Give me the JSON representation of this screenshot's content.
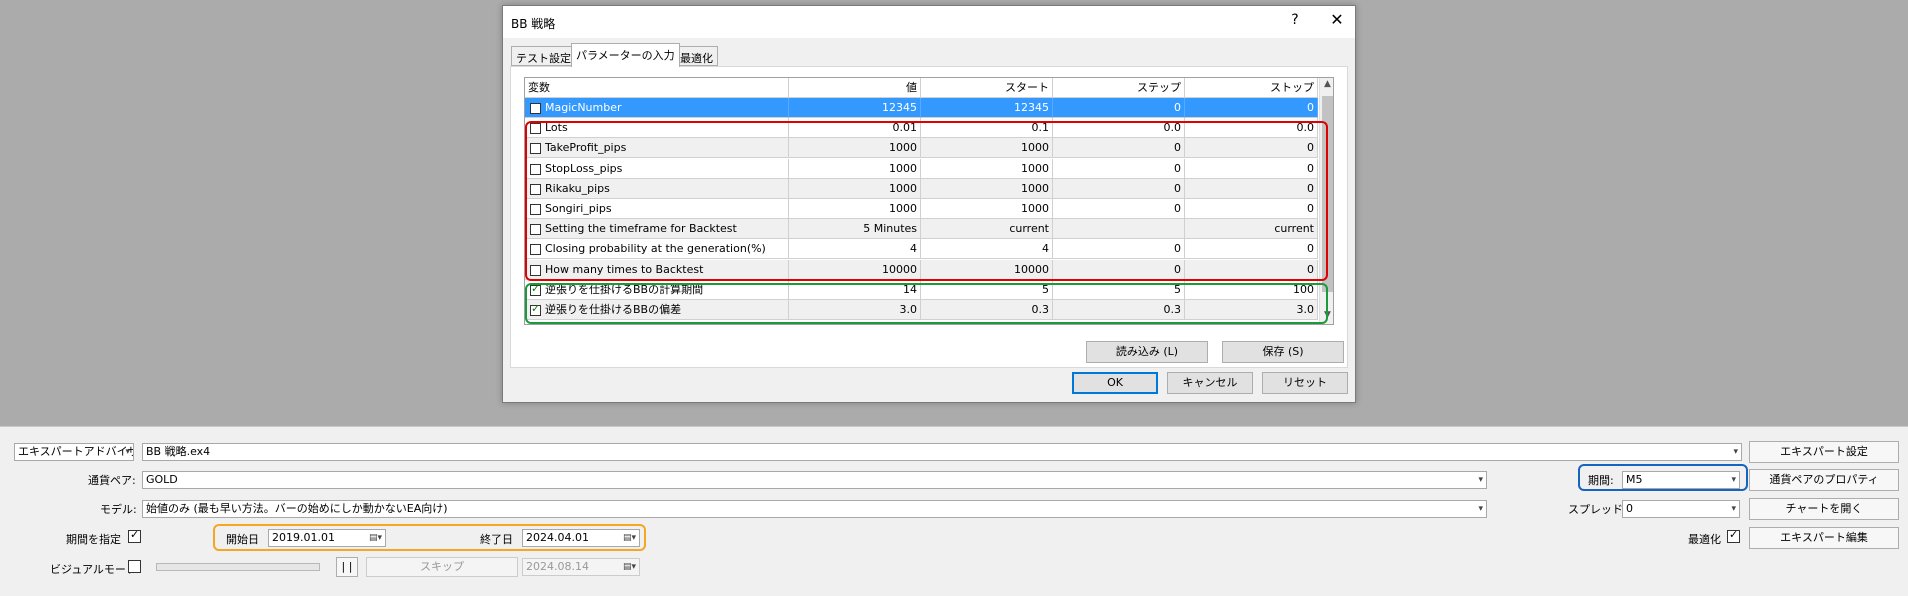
{
  "dialog": {
    "title": "BB 戦略",
    "help": "?",
    "close": "✕",
    "tabs": [
      "テスト設定",
      "パラメーターの入力",
      "最適化"
    ],
    "columns": [
      "変数",
      "値",
      "スタート",
      "ステップ",
      "ストップ"
    ],
    "rows": [
      {
        "name": "MagicNumber",
        "value": "12345",
        "start": "12345",
        "step": "0",
        "stop": "0",
        "checked": false
      },
      {
        "name": "Lots",
        "value": "0.01",
        "start": "0.1",
        "step": "0.0",
        "stop": "0.0",
        "checked": false
      },
      {
        "name": "TakeProfit_pips",
        "value": "1000",
        "start": "1000",
        "step": "0",
        "stop": "0",
        "checked": false
      },
      {
        "name": "StopLoss_pips",
        "value": "1000",
        "start": "1000",
        "step": "0",
        "stop": "0",
        "checked": false
      },
      {
        "name": "Rikaku_pips",
        "value": "1000",
        "start": "1000",
        "step": "0",
        "stop": "0",
        "checked": false
      },
      {
        "name": "Songiri_pips",
        "value": "1000",
        "start": "1000",
        "step": "0",
        "stop": "0",
        "checked": false
      },
      {
        "name": "Setting the timeframe for Backtest",
        "value": "5 Minutes",
        "start": "current",
        "step": "",
        "stop": "current",
        "checked": false
      },
      {
        "name": "Closing probability at the generation(%)",
        "value": "4",
        "start": "4",
        "step": "0",
        "stop": "0",
        "checked": false
      },
      {
        "name": "How many times to Backtest",
        "value": "10000",
        "start": "10000",
        "step": "0",
        "stop": "0",
        "checked": false
      },
      {
        "name": "逆張りを仕掛けるBBの計算期間",
        "value": "14",
        "start": "5",
        "step": "5",
        "stop": "100",
        "checked": true
      },
      {
        "name": "逆張りを仕掛けるBBの偏差",
        "value": "3.0",
        "start": "0.3",
        "step": "0.3",
        "stop": "3.0",
        "checked": true
      }
    ],
    "load_label": "読み込み (L)",
    "save_label": "保存 (S)",
    "ok_label": "OK",
    "cancel_label": "キャンセル",
    "reset_label": "リセット"
  },
  "bottom": {
    "type_combo": "エキスパートアドバイザ",
    "ea_file": "BB 戦略.ex4",
    "symbol_label": "通貨ペア:",
    "symbol_value": "GOLD",
    "model_label": "モデル:",
    "model_value": "始値のみ (最も早い方法。バーの始めにしか動かないEA向け)",
    "use_date_label": "期間を指定",
    "use_date_checked": true,
    "start_label": "開始日",
    "start_value": "2019.01.01",
    "end_label": "終了日",
    "end_value": "2024.04.01",
    "visual_label": "ビジュアルモード",
    "pause_label": "| |",
    "skip_label": "スキップ",
    "skip_date": "2024.08.14",
    "period_label": "期間:",
    "period_value": "M5",
    "spread_label": "スプレッド:",
    "spread_value": "0",
    "optimize_label": "最適化",
    "optimize_checked": true,
    "btn_expert_settings": "エキスパート設定",
    "btn_symbol_props": "通貨ペアのプロパティ",
    "btn_open_chart": "チャートを開く",
    "btn_edit_expert": "エキスパート編集"
  },
  "colors": {
    "highlight_red": "#e00000",
    "highlight_green": "#1a9a3a",
    "highlight_orange": "#f5a623",
    "highlight_blue": "#1565c0",
    "selection": "#3399ff"
  }
}
